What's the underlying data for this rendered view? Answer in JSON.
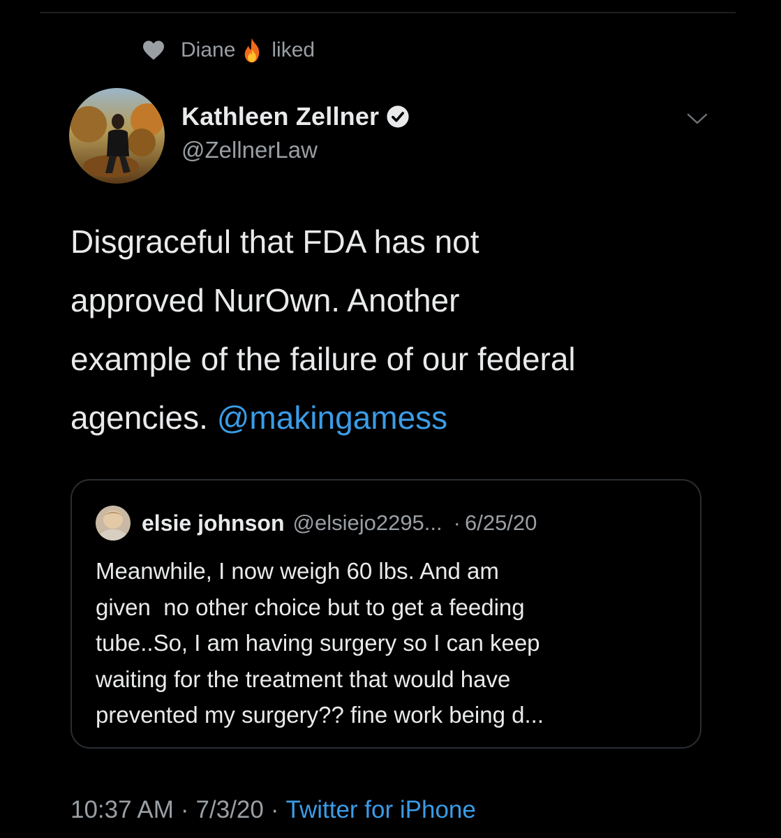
{
  "social_context": {
    "name": "Diane",
    "action": "liked",
    "heart_icon": "heart-icon",
    "emoji_icon": "fire-emoji-icon"
  },
  "tweet": {
    "author": {
      "name": "Kathleen Zellner",
      "handle": "@ZellnerLaw",
      "verified": true
    },
    "text_lines": [
      "Disgraceful that FDA has not",
      "approved NurOwn. Another",
      "example of the failure of our federal",
      "agencies. "
    ],
    "mention": "@makingamess",
    "quoted": {
      "name": "elsie johnson",
      "handle": "@elsiejo2295...",
      "separator": "·",
      "date": "6/25/20",
      "text": "Meanwhile, I now weigh 60 lbs. And am\ngiven  no other choice but to get a feeding\ntube..So, I am having surgery so I can keep\nwaiting for the treatment that would have\nprevented my surgery?? fine work being d..."
    },
    "time": "10:37 AM",
    "date": "7/3/20",
    "separator": "·",
    "source": "Twitter for iPhone"
  },
  "colors": {
    "background": "#000000",
    "text_primary": "#e9eaeb",
    "text_secondary": "#9a9fa4",
    "link": "#3b9ce6",
    "border": "#2a2e32"
  }
}
